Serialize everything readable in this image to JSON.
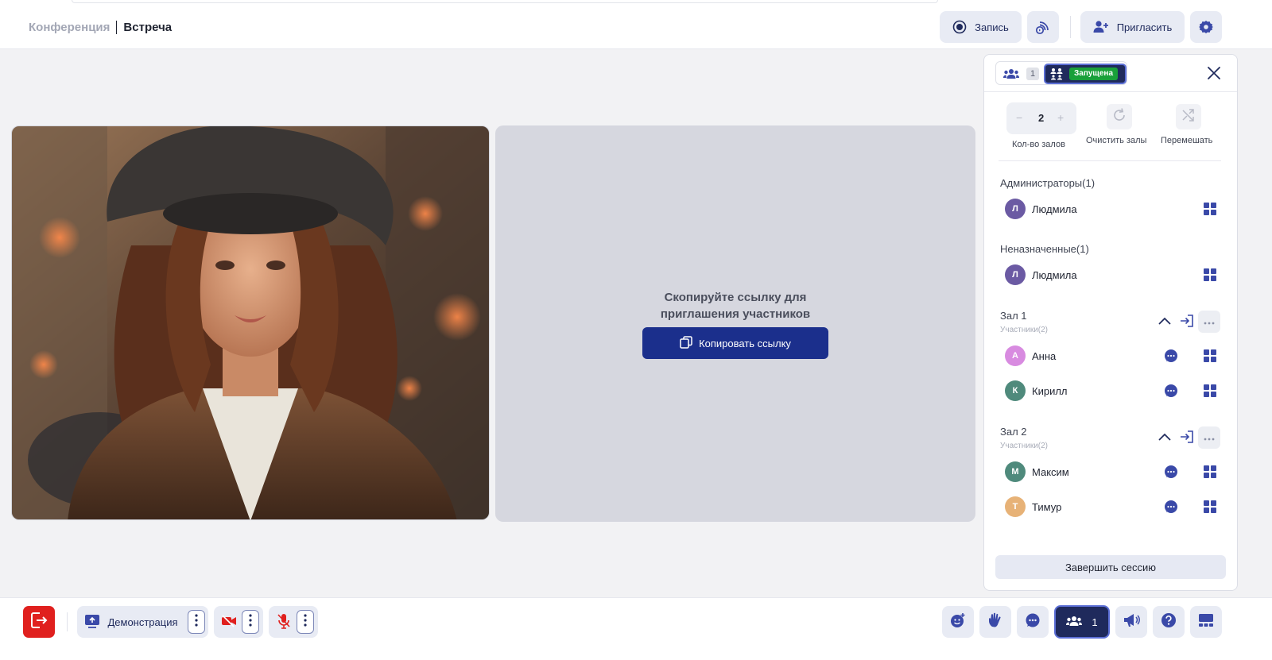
{
  "header": {
    "breadcrumb_parent": "Конференция",
    "breadcrumb_current": "Встреча",
    "record_label": "Запись",
    "invite_label": "Пригласить"
  },
  "stage": {
    "invite_text_line1": "Скопируйте ссылку для",
    "invite_text_line2": "приглашения участников",
    "copy_link_label": "Копировать ссылку"
  },
  "panel": {
    "participants_count": "1",
    "rooms_status": "Запущена",
    "rooms_count": "2",
    "rooms_count_label": "Кол-во залов",
    "clear_rooms_label": "Очистить залы",
    "shuffle_label": "Перемешать",
    "admins_title": "Администраторы(1)",
    "admins": [
      {
        "initial": "Л",
        "name": "Людмила",
        "color": "#6b5aa3"
      }
    ],
    "unassigned_title": "Неназначенные(1)",
    "unassigned": [
      {
        "initial": "Л",
        "name": "Людмила",
        "color": "#6b5aa3"
      }
    ],
    "rooms": [
      {
        "title": "Зал 1",
        "subtitle": "Участники(2)",
        "members": [
          {
            "initial": "А",
            "name": "Анна",
            "color": "#d88be0"
          },
          {
            "initial": "К",
            "name": "Кирилл",
            "color": "#4f8a7c"
          }
        ]
      },
      {
        "title": "Зал 2",
        "subtitle": "Участники(2)",
        "members": [
          {
            "initial": "М",
            "name": "Максим",
            "color": "#4f8a7c"
          },
          {
            "initial": "Т",
            "name": "Тимур",
            "color": "#e7b277"
          }
        ]
      }
    ],
    "end_session_label": "Завершить сессию"
  },
  "footer": {
    "demo_label": "Демонстрация",
    "people_count": "1"
  },
  "colors": {
    "accent": "#1b2f8c",
    "nav_dark": "#1f2a5c",
    "danger": "#e0201e",
    "success": "#19a03a"
  },
  "icons": [
    "record-icon",
    "broadcast-icon",
    "invite-user-icon",
    "settings-icon",
    "copy-icon",
    "people-icon",
    "rooms-icon",
    "close-icon",
    "refresh-icon",
    "shuffle-icon",
    "grid-icon",
    "chat-icon",
    "chevron-up-icon",
    "enter-room-icon",
    "more-icon",
    "leave-icon",
    "screen-share-icon",
    "camera-off-icon",
    "mic-off-icon",
    "emoji-icon",
    "raise-hand-icon",
    "megaphone-icon",
    "help-icon",
    "layout-icon"
  ]
}
